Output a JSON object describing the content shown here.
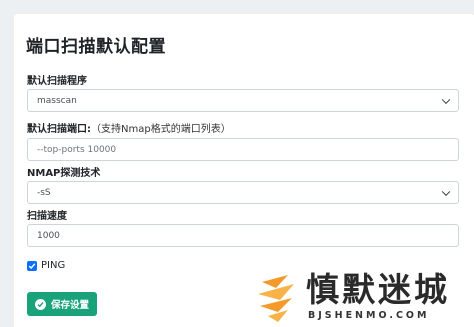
{
  "page": {
    "title": "端口扫描默认配置"
  },
  "form": {
    "scanner": {
      "label": "默认扫描程序",
      "value": "masscan"
    },
    "ports": {
      "label": "默认扫描端口:",
      "hint": "（支持Nmap格式的端口列表）",
      "placeholder": "--top-ports 10000"
    },
    "nmap_tech": {
      "label": "NMAP探测技术",
      "value": "-sS"
    },
    "speed": {
      "label": "扫描速度",
      "value": "1000"
    },
    "ping": {
      "label": "PING",
      "checked": true
    },
    "save_label": "保存设置"
  },
  "watermark": {
    "title": "慎默迷城",
    "subtitle": "BJSHENMO.COM"
  },
  "colors": {
    "primary": "#0d6efd",
    "save_button": "#1aa37a",
    "logo_orange": "#f39a2b"
  }
}
